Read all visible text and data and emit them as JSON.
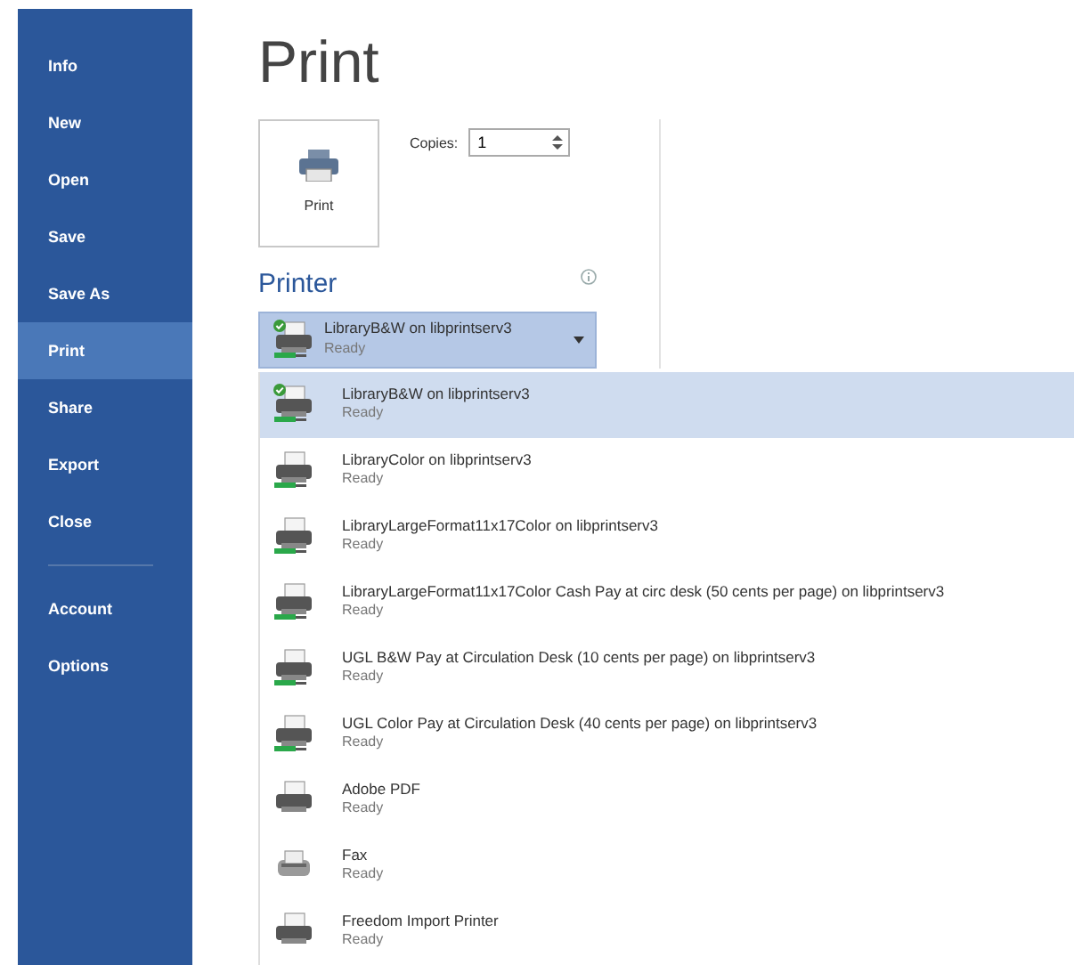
{
  "sidebar": {
    "items": [
      {
        "label": "Info",
        "selected": false
      },
      {
        "label": "New",
        "selected": false
      },
      {
        "label": "Open",
        "selected": false
      },
      {
        "label": "Save",
        "selected": false
      },
      {
        "label": "Save As",
        "selected": false
      },
      {
        "label": "Print",
        "selected": true
      },
      {
        "label": "Share",
        "selected": false
      },
      {
        "label": "Export",
        "selected": false
      },
      {
        "label": "Close",
        "selected": false,
        "separator_after": true
      },
      {
        "label": "Account",
        "selected": false
      },
      {
        "label": "Options",
        "selected": false
      }
    ]
  },
  "title": "Print",
  "print_button": {
    "label": "Print"
  },
  "copies": {
    "label": "Copies:",
    "value": "1"
  },
  "printer": {
    "heading": "Printer",
    "current": {
      "name": "LibraryB&W on libprintserv3",
      "status": "Ready",
      "kind": "network",
      "default": true
    },
    "options": [
      {
        "name": "LibraryB&W on libprintserv3",
        "status": "Ready",
        "kind": "network",
        "default": true,
        "selected": true
      },
      {
        "name": "LibraryColor on libprintserv3",
        "status": "Ready",
        "kind": "network",
        "default": false,
        "selected": false
      },
      {
        "name": "LibraryLargeFormat11x17Color on libprintserv3",
        "status": "Ready",
        "kind": "network",
        "default": false,
        "selected": false
      },
      {
        "name": "LibraryLargeFormat11x17Color Cash Pay at circ desk (50 cents per page) on libprintserv3",
        "status": "Ready",
        "kind": "network",
        "default": false,
        "selected": false
      },
      {
        "name": "UGL B&W Pay at Circulation Desk (10 cents per page) on libprintserv3",
        "status": "Ready",
        "kind": "network",
        "default": false,
        "selected": false
      },
      {
        "name": "UGL Color Pay at Circulation Desk (40 cents per page) on libprintserv3",
        "status": "Ready",
        "kind": "network",
        "default": false,
        "selected": false
      },
      {
        "name": "Adobe PDF",
        "status": "Ready",
        "kind": "local",
        "default": false,
        "selected": false
      },
      {
        "name": "Fax",
        "status": "Ready",
        "kind": "fax",
        "default": false,
        "selected": false
      },
      {
        "name": "Freedom Import Printer",
        "status": "Ready",
        "kind": "local",
        "default": false,
        "selected": false
      }
    ]
  }
}
